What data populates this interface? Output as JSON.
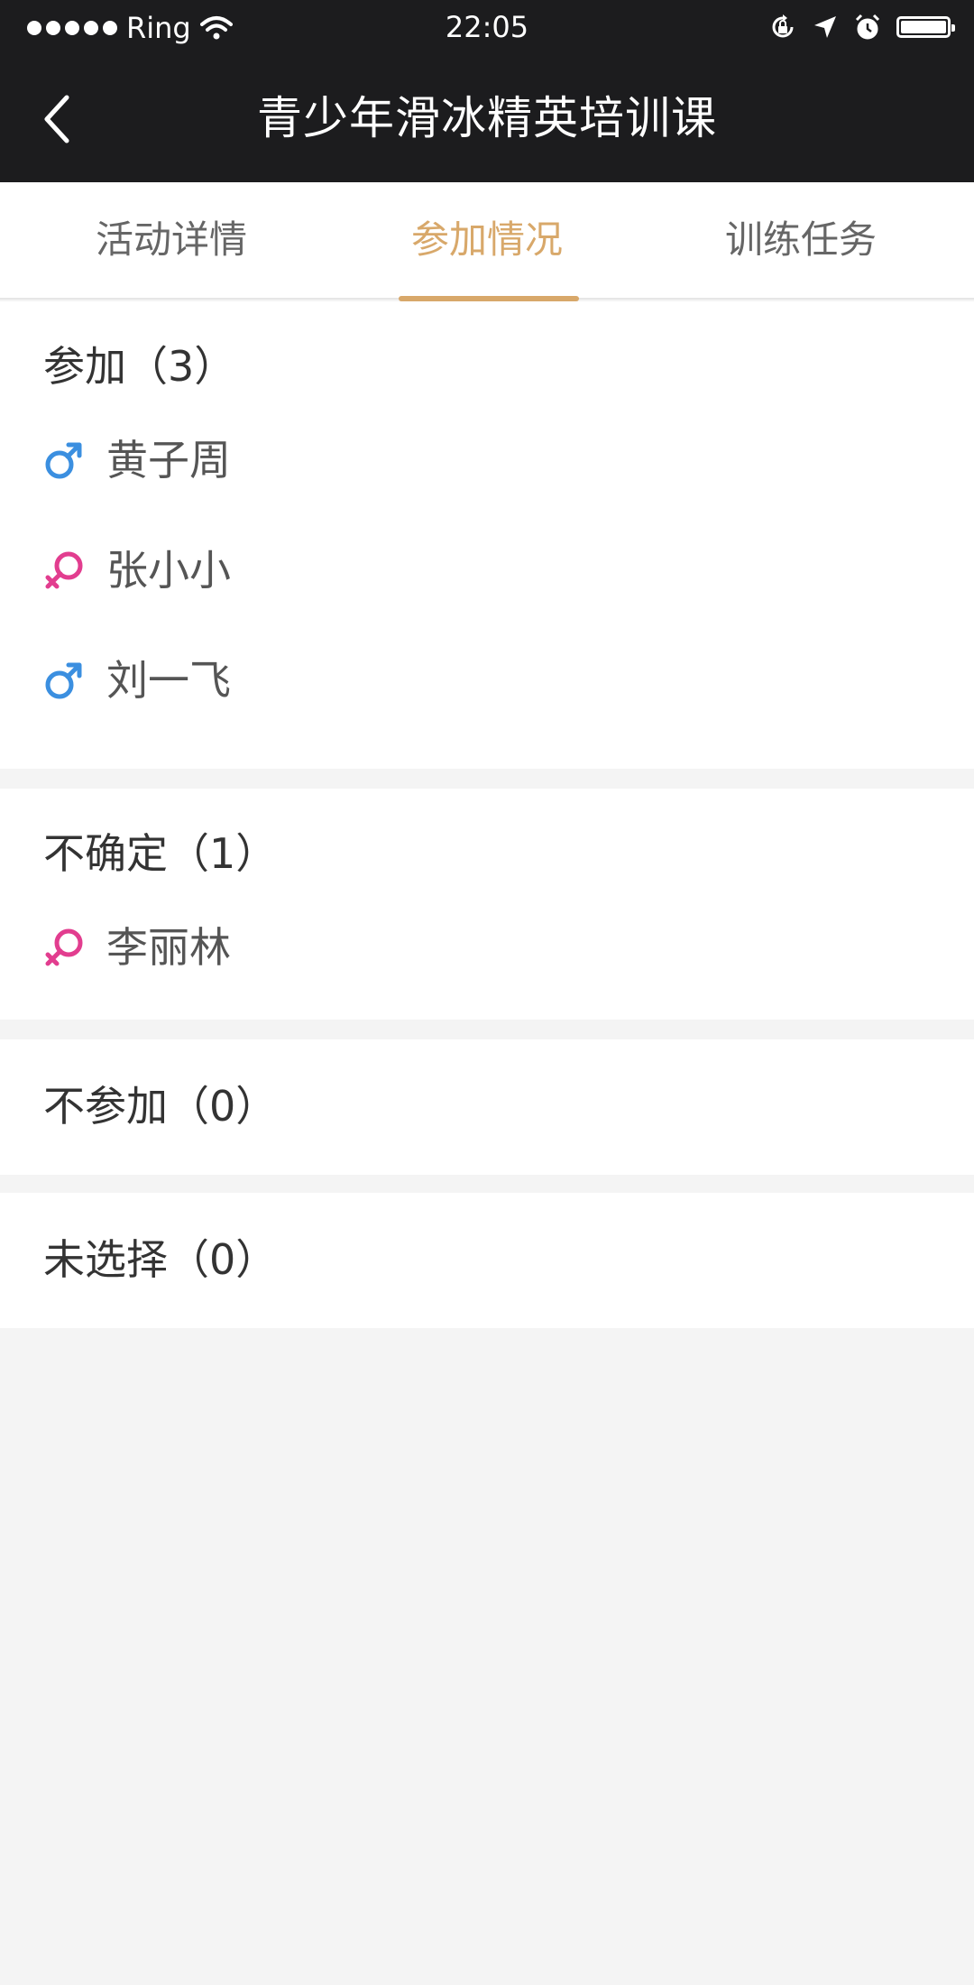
{
  "status_bar": {
    "carrier": "Ring",
    "time": "22:05"
  },
  "nav": {
    "title": "青少年滑冰精英培训课"
  },
  "tabs": [
    {
      "label": "活动详情",
      "active": false
    },
    {
      "label": "参加情况",
      "active": true
    },
    {
      "label": "训练任务",
      "active": false
    }
  ],
  "sections": {
    "attending": {
      "title": "参加（3）",
      "members": [
        {
          "name": "黄子周",
          "gender": "male"
        },
        {
          "name": "张小小",
          "gender": "female"
        },
        {
          "name": "刘一飞",
          "gender": "male"
        }
      ]
    },
    "undecided": {
      "title": "不确定（1）",
      "members": [
        {
          "name": "李丽林",
          "gender": "female"
        }
      ]
    },
    "not_attending": {
      "title": "不参加（0）"
    },
    "unselected": {
      "title": "未选择（0）"
    }
  },
  "colors": {
    "accent": "#d8a86a",
    "male": "#3b8fe0",
    "female": "#e23d8f",
    "header_bg": "#1c1c1e"
  }
}
